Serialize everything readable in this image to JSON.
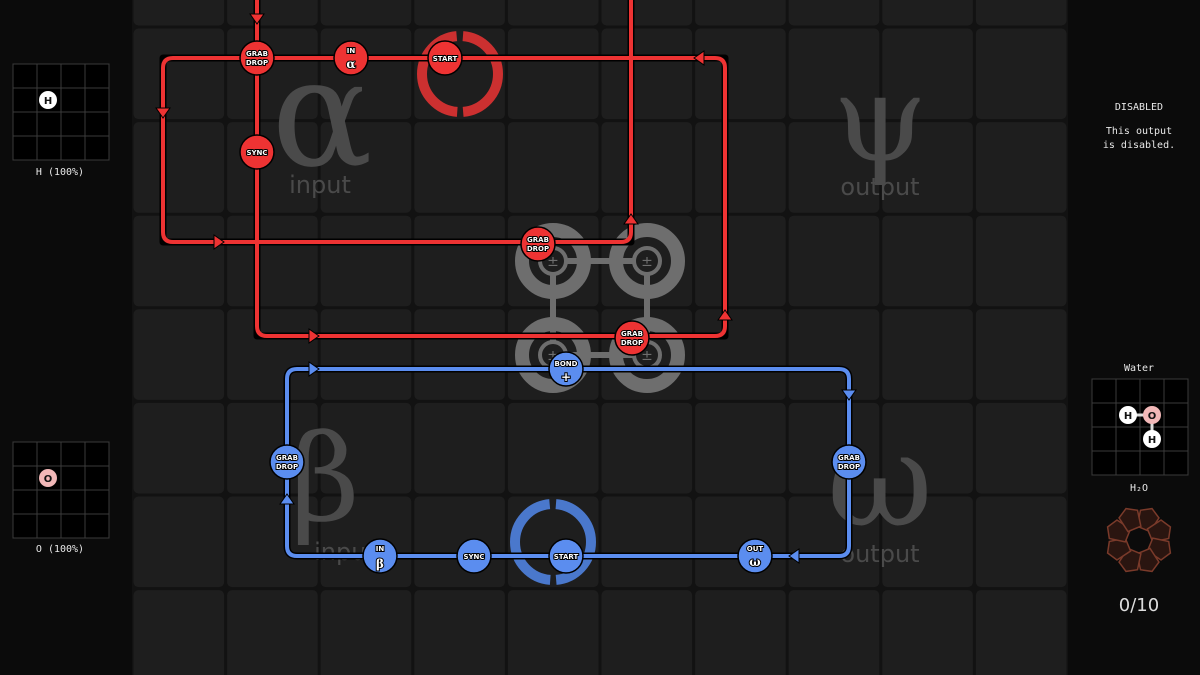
{
  "colors": {
    "red_waldo": "#ee3333",
    "blue_waldo": "#5b8def",
    "bonder": "#6e6e6e",
    "hydrogen": "#ffffff",
    "oxygen": "#f2b8b8",
    "progress_icon": "#7a3a2a"
  },
  "inputs": [
    {
      "atom": "H",
      "label": "H (100%)"
    },
    {
      "atom": "O",
      "label": "O (100%)"
    }
  ],
  "regions": {
    "alpha": {
      "symbol": "α",
      "label": "input"
    },
    "psi": {
      "symbol": "ψ",
      "label": "output"
    },
    "beta": {
      "symbol": "β",
      "label": "input"
    },
    "omega": {
      "symbol": "ω",
      "label": "output"
    }
  },
  "red_waldo": {
    "grab_drop_1": {
      "line1": "GRAB",
      "line2": "DROP"
    },
    "in_alpha": {
      "line1": "IN",
      "symbol": "α"
    },
    "start": {
      "line1": "START"
    },
    "sync": {
      "line1": "SYNC"
    },
    "grab_drop_2": {
      "line1": "GRAB",
      "line2": "DROP"
    },
    "grab_drop_3": {
      "line1": "GRAB",
      "line2": "DROP"
    }
  },
  "blue_waldo": {
    "bond_plus": {
      "line1": "BOND",
      "symbol": "+"
    },
    "grab_drop_1": {
      "line1": "GRAB",
      "line2": "DROP"
    },
    "grab_drop_2": {
      "line1": "GRAB",
      "line2": "DROP"
    },
    "out_omega": {
      "line1": "OUT",
      "symbol": "ω"
    },
    "start": {
      "line1": "START"
    },
    "sync": {
      "line1": "SYNC"
    },
    "in_beta": {
      "line1": "IN",
      "symbol": "β"
    }
  },
  "bonders": {
    "sign": "±"
  },
  "output_psi": {
    "status": "DISABLED",
    "message_line1": "This output",
    "message_line2": "is disabled."
  },
  "output_omega": {
    "name": "Water",
    "formula": "H₂O",
    "atoms": [
      "H",
      "O",
      "H"
    ],
    "progress": "0/10",
    "completed": 0,
    "required": 10
  }
}
